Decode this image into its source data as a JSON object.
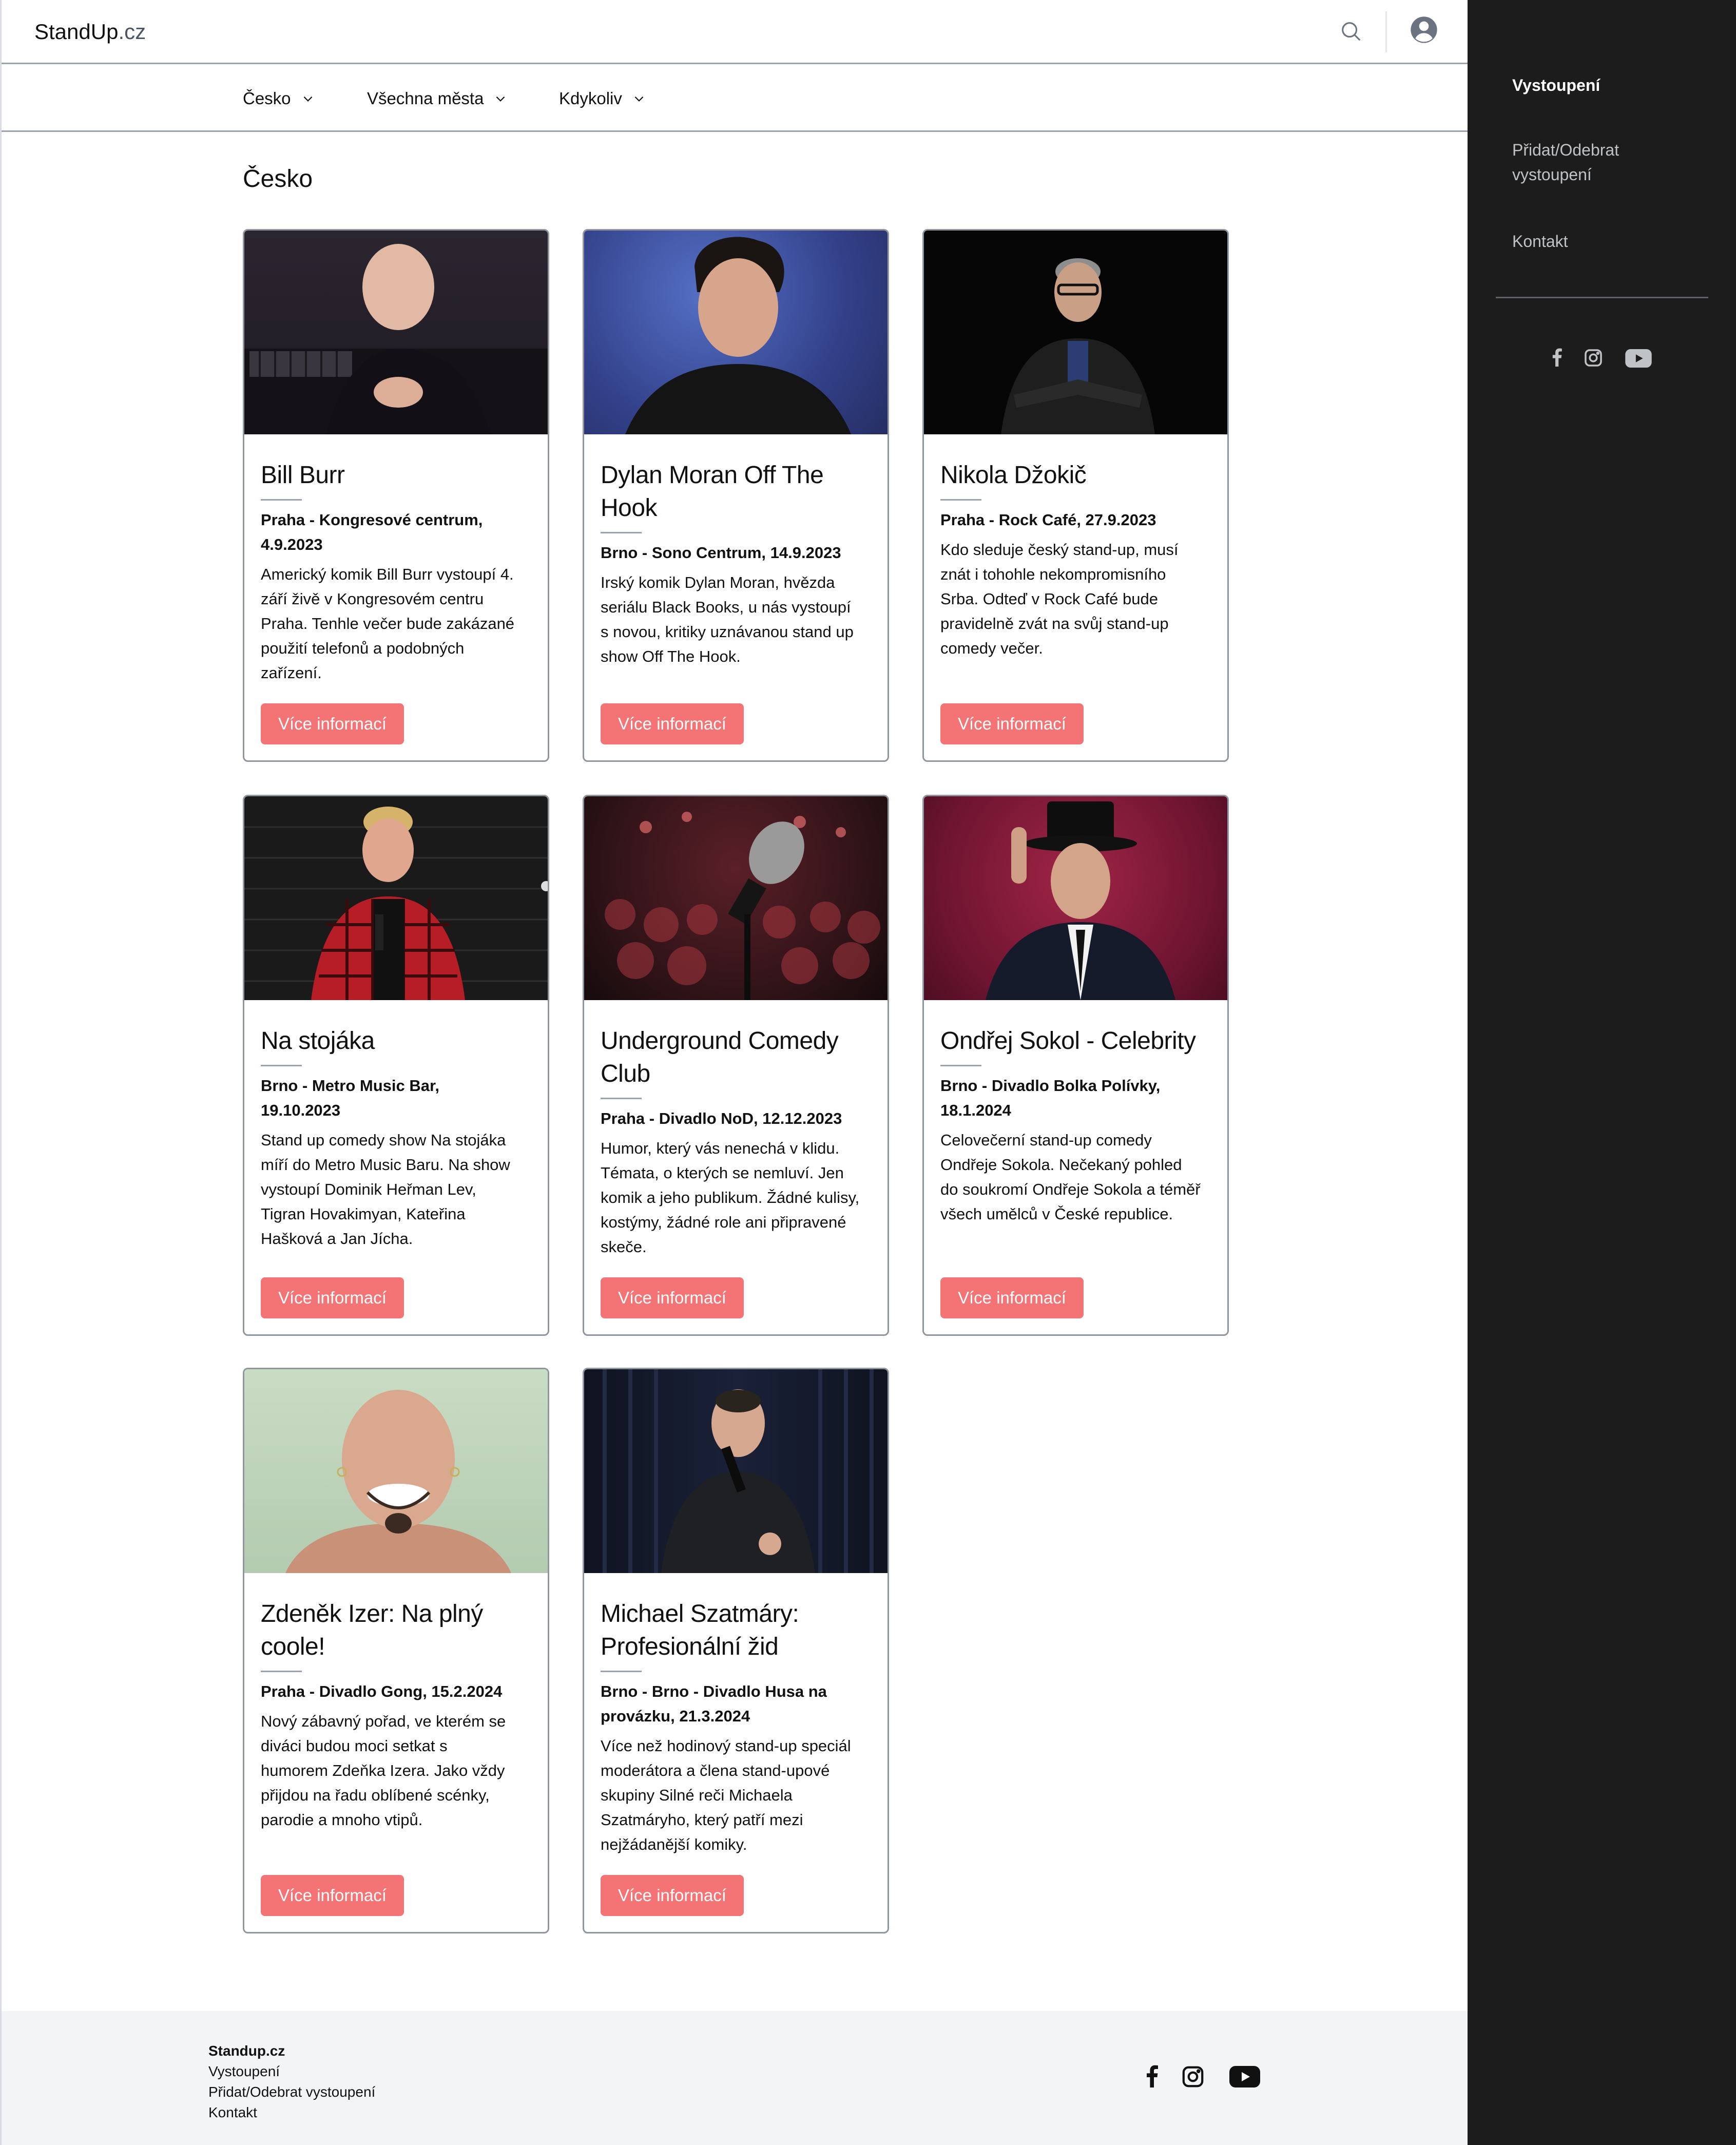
{
  "header": {
    "logo_main": "StandUp",
    "logo_tld": ".cz"
  },
  "filters": {
    "country": "Česko",
    "city": "Všechna města",
    "date": "Kdykoliv"
  },
  "page_title": "Česko",
  "cards": [
    {
      "title_lines": [
        "Bill Burr"
      ],
      "venue_lines": [
        "Praha - Kongresové centrum,",
        "4.9.2023"
      ],
      "desc_lines": [
        "Americký komik Bill Burr vystoupí 4.",
        "září živě v Kongresovém centru",
        "Praha. Tenhle večer bude zakázané",
        "použití telefonů a podobných",
        "zařízení."
      ],
      "button": "Více informací"
    },
    {
      "title_lines": [
        "Dylan Moran Off The",
        "Hook"
      ],
      "venue_lines": [
        "Brno - Sono Centrum, 14.9.2023"
      ],
      "desc_lines": [
        "Irský komik Dylan Moran, hvězda",
        "seriálu Black Books, u nás vystoupí",
        "s novou, kritiky uznávanou stand up",
        "show Off The Hook."
      ],
      "button": "Více informací"
    },
    {
      "title_lines": [
        "Nikola Džokič"
      ],
      "venue_lines": [
        "Praha - Rock Café, 27.9.2023"
      ],
      "desc_lines": [
        "Kdo sleduje český stand-up, musí",
        "znát i tohohle nekompromisního",
        "Srba. Odteď v Rock Café bude",
        "pravidelně zvát na svůj stand-up",
        "comedy večer."
      ],
      "button": "Více informací"
    },
    {
      "title_lines": [
        "Na stojáka"
      ],
      "venue_lines": [
        "Brno - Metro Music Bar,",
        "19.10.2023"
      ],
      "desc_lines": [
        "Stand up comedy show Na stojáka",
        "míří do Metro Music Baru. Na show",
        "vystoupí Dominik Heřman Lev,",
        "Tigran Hovakimyan, Kateřina",
        "Hašková a Jan Jícha."
      ],
      "button": "Více informací"
    },
    {
      "title_lines": [
        "Underground Comedy",
        "Club"
      ],
      "venue_lines": [
        "Praha - Divadlo NoD, 12.12.2023"
      ],
      "desc_lines": [
        "Humor, který vás nenechá v klidu.",
        "Témata, o kterých se nemluví. Jen",
        "komik a jeho publikum. Žádné kulisy,",
        "kostýmy, žádné role ani připravené",
        "skeče."
      ],
      "button": "Více informací"
    },
    {
      "title_lines": [
        "Ondřej Sokol - Celebrity"
      ],
      "venue_lines": [
        "Brno - Divadlo Bolka Polívky,",
        "18.1.2024"
      ],
      "desc_lines": [
        "Celovečerní stand-up comedy",
        "Ondřeje Sokola. Nečekaný pohled",
        "do soukromí Ondřeje Sokola a téměř",
        "všech umělců v České republice."
      ],
      "button": "Více informací"
    },
    {
      "title_lines": [
        "Zdeněk Izer: Na plný",
        "coole!"
      ],
      "venue_lines": [
        "Praha - Divadlo Gong, 15.2.2024"
      ],
      "desc_lines": [
        "Nový zábavný pořad, ve kterém se",
        "diváci budou moci setkat s",
        "humorem Zdeňka Izera. Jako vždy",
        "přijdou na řadu oblíbené scénky,",
        "parodie a mnoho vtipů."
      ],
      "button": "Více informací"
    },
    {
      "title_lines": [
        "Michael Szatmáry:",
        "Profesionální žid"
      ],
      "venue_lines": [
        "Brno - Brno - Divadlo Husa na",
        "provázku, 21.3.2024"
      ],
      "desc_lines": [
        "Více než hodinový stand-up speciál",
        "moderátora a člena stand-upové",
        "skupiny Silné reči Michaela",
        "Szatmáryho, který patří mezi",
        "nejžádanější komiky."
      ],
      "button": "Více informací"
    }
  ],
  "footer": {
    "brand": "Standup.cz",
    "links": [
      "Vystoupení",
      "Přidat/Odebrat vystoupení",
      "Kontakt"
    ]
  },
  "sidebar": {
    "active": "Vystoupení",
    "item2_line1": "Přidat/Odebrat",
    "item2_line2": "vystoupení",
    "item3": "Kontakt"
  },
  "icons": [
    "search-icon",
    "user-avatar-icon",
    "chevron-down-icon",
    "facebook-icon",
    "instagram-icon",
    "youtube-icon"
  ],
  "colors": {
    "accent": "#f47374",
    "sidebar_bg": "#1c1c1c",
    "footer_bg": "#f3f4f6"
  }
}
